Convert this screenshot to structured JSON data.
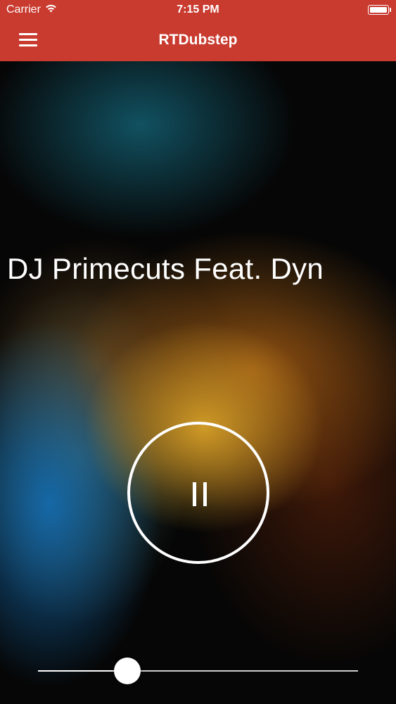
{
  "status_bar": {
    "carrier": "Carrier",
    "time": "7:15 PM",
    "wifi_icon": "wifi-icon",
    "battery_icon": "battery-icon",
    "battery_level": 1.0
  },
  "nav": {
    "title": "RTDubstep",
    "menu_icon": "hamburger-menu-icon",
    "color": "#c93a2f"
  },
  "player": {
    "track_title": "DJ Primecuts Feat. Dyn",
    "state": "playing",
    "control_icon": "pause-icon",
    "volume": 0.28
  }
}
